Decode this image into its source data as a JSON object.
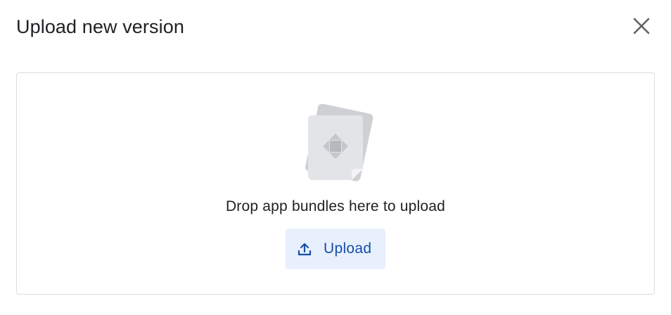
{
  "dialog": {
    "title": "Upload new version",
    "close_icon": "close-icon"
  },
  "dropzone": {
    "illustration_icon": "app-bundle-file-icon",
    "instruction": "Drop app bundles here to upload",
    "upload_button": {
      "label": "Upload",
      "icon": "upload-icon"
    }
  },
  "colors": {
    "title_text": "#202124",
    "border": "#dadce0",
    "button_bg": "#e8f0fe",
    "button_text": "#174ea6",
    "icon_gray": "#5f6368"
  }
}
